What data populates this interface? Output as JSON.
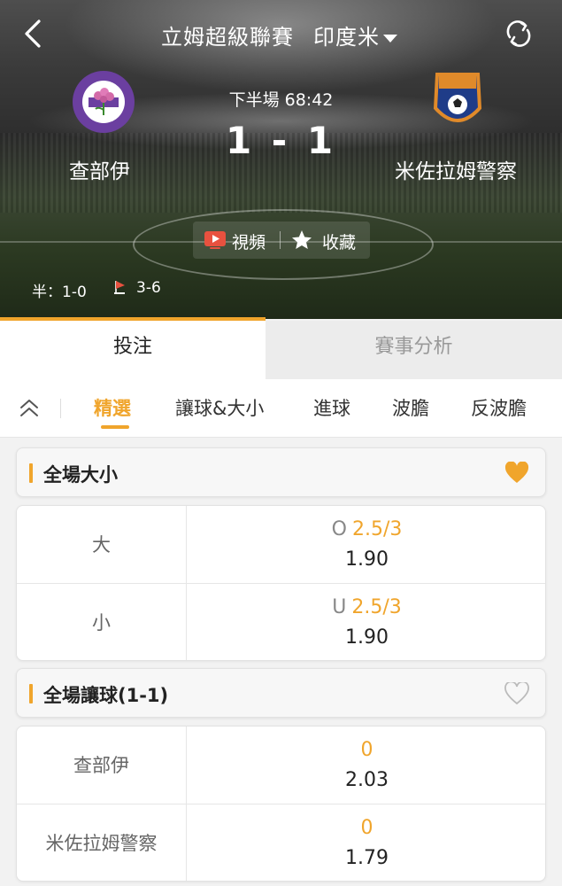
{
  "header": {
    "title": "立姆超級聯賽",
    "league_selector": "印度米",
    "status": "下半場  68:42",
    "score": "1 - 1",
    "home_team": "查部伊",
    "away_team": "米佐拉姆警察",
    "home_crest_icon": "chawnpui-fc-crest-icon",
    "away_crest_icon": "mizoram-police-fc-crest-icon",
    "video_label": "視頻",
    "favorite_label": "收藏",
    "half_time": "半：1-0",
    "corners": "3-6"
  },
  "main_tabs": [
    {
      "label": "投注",
      "active": true
    },
    {
      "label": "賽事分析",
      "active": false
    }
  ],
  "sub_tabs": [
    {
      "label": "精選",
      "active": true
    },
    {
      "label": "讓球&大小",
      "active": false
    },
    {
      "label": "進球",
      "active": false
    },
    {
      "label": "波膽",
      "active": false
    },
    {
      "label": "反波膽",
      "active": false
    }
  ],
  "sections": [
    {
      "title": "全場大小",
      "favorited": true,
      "rows": [
        {
          "label": "大",
          "prefix": "O",
          "handicap": "2.5/3",
          "odds": "1.90"
        },
        {
          "label": "小",
          "prefix": "U",
          "handicap": "2.5/3",
          "odds": "1.90"
        }
      ]
    },
    {
      "title": "全場讓球(1-1)",
      "favorited": false,
      "rows": [
        {
          "label": "查部伊",
          "prefix": "",
          "handicap": "0",
          "odds": "2.03"
        },
        {
          "label": "米佐拉姆警察",
          "prefix": "",
          "handicap": "0",
          "odds": "1.79"
        }
      ]
    }
  ],
  "colors": {
    "accent": "#f0a52c",
    "heart_active": "#f0a52c",
    "heart_inactive": "#bbbbbb"
  }
}
